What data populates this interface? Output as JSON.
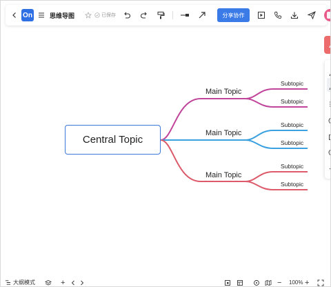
{
  "toolbar": {
    "logo_text": "On",
    "doc_title": "思维导图",
    "saved_status": "已保存",
    "share_label": "分享协作"
  },
  "mindmap": {
    "central": "Central Topic",
    "branches": [
      {
        "label": "Main Topic",
        "color": "#c0449a",
        "subtopics": [
          "Subtopic",
          "Subtopic"
        ]
      },
      {
        "label": "Main Topic",
        "color": "#3aa0e0",
        "subtopics": [
          "Subtopic",
          "Subtopic"
        ]
      },
      {
        "label": "Main Topic",
        "color": "#dc5a6a",
        "subtopics": [
          "Subtopic",
          "Subtopic"
        ]
      }
    ]
  },
  "colors": {
    "accent": "#3b7be8",
    "central_border": "#3a78d8"
  },
  "bottombar": {
    "outline_label": "大纲模式",
    "zoom": "100%"
  }
}
